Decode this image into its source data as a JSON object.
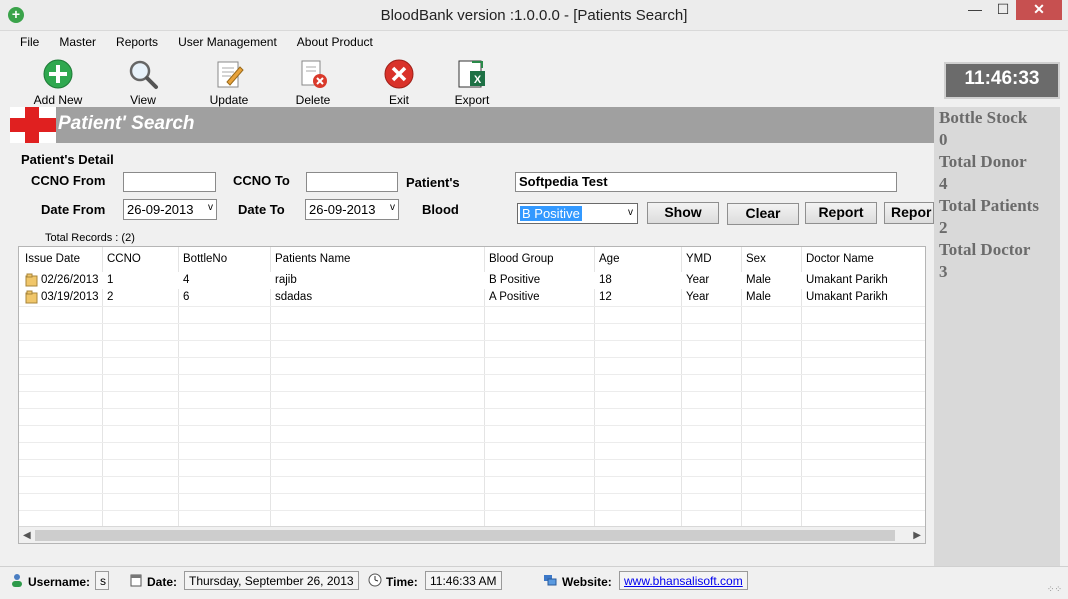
{
  "window": {
    "title": "BloodBank version :1.0.0.0 - [Patients Search]",
    "min": "—",
    "max": "☐",
    "close": "✕"
  },
  "menu": [
    "File",
    "Master",
    "Reports",
    "User Management",
    "About Product"
  ],
  "toolbar": {
    "add": "Add New",
    "view": "View",
    "update": "Update",
    "delete": "Delete",
    "exit": "Exit",
    "export": "Export"
  },
  "clock": "11:46:33",
  "stats": {
    "bottle_stock_label": "Bottle Stock",
    "bottle_stock_value": "0",
    "total_donor_label": "Total Donor",
    "total_donor_value": "4",
    "total_patients_label": "Total Patients",
    "total_patients_value": "2",
    "total_doctor_label": "Total Doctor",
    "total_doctor_value": "3"
  },
  "banner_title": "Patient' Search",
  "form": {
    "section_title": "Patient's Detail",
    "ccno_from_label": "CCNO From",
    "ccno_from_value": "",
    "ccno_to_label": "CCNO To",
    "ccno_to_value": "",
    "patient_label": "Patient's",
    "patient_value": "Softpedia Test",
    "date_from_label": "Date From",
    "date_from_value": "26-09-2013",
    "date_to_label": "Date To",
    "date_to_value": "26-09-2013",
    "blood_label": "Blood",
    "blood_value": "B Positive",
    "show": "Show",
    "clear": "Clear",
    "report": "Report",
    "report2": "Repor"
  },
  "total_records": "Total Records : (2)",
  "table": {
    "headers": [
      "Issue Date",
      "CCNO",
      "BottleNo",
      "Patients Name",
      "Blood Group",
      "Age",
      "YMD",
      "Sex",
      "Doctor Name"
    ],
    "rows": [
      [
        "02/26/2013",
        "1",
        "4",
        "rajib",
        "B Positive",
        "18",
        "Year",
        "Male",
        "Umakant Parikh"
      ],
      [
        "03/19/2013",
        "2",
        "6",
        "sdadas",
        "A Positive",
        "12",
        "Year",
        "Male",
        "Umakant Parikh"
      ]
    ]
  },
  "status": {
    "username_label": "Username:",
    "username_value": "s",
    "date_label": "Date:",
    "date_value": "Thursday, September 26, 2013",
    "time_label": "Time:",
    "time_value": "11:46:33 AM",
    "website_label": "Website:",
    "website_value": "www.bhansalisoft.com"
  }
}
